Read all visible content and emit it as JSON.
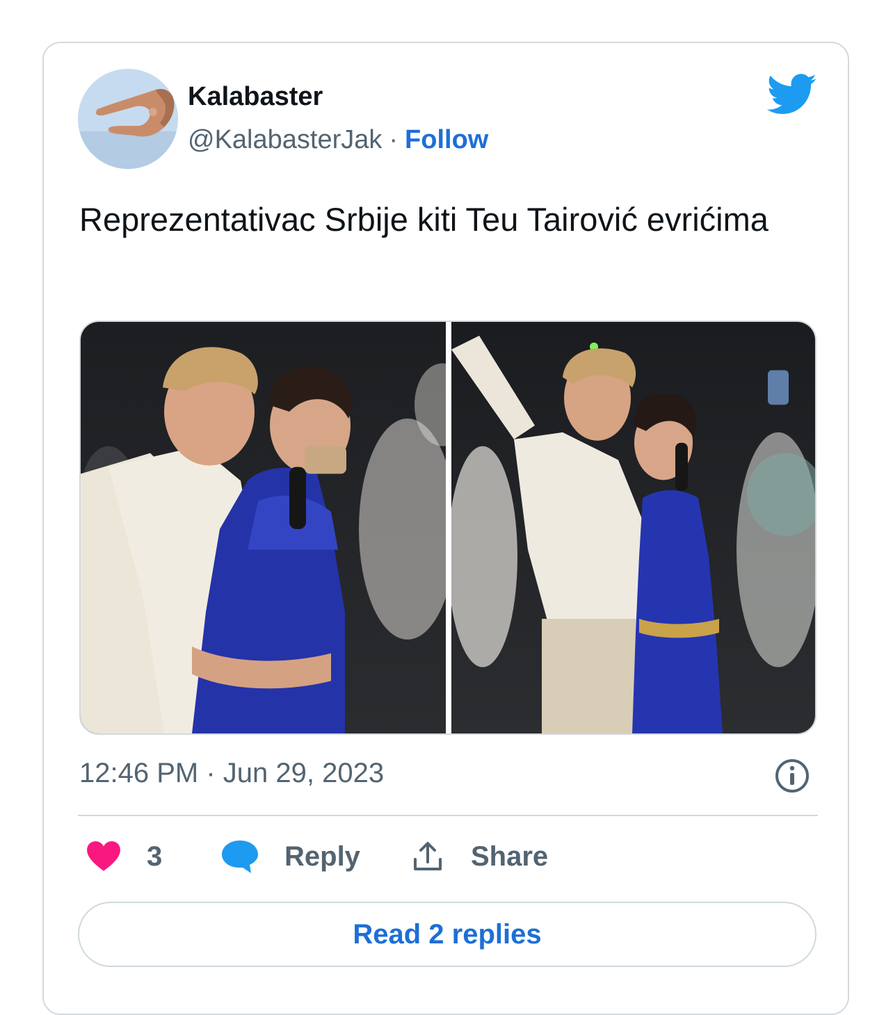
{
  "author": {
    "display_name": "Kalabaster",
    "handle": "@KalabasterJak",
    "separator": "·",
    "follow_label": "Follow",
    "avatar_icon": "hand-gesture-avatar"
  },
  "brand": {
    "icon": "twitter-bird-icon",
    "color": "#1d9bf0"
  },
  "tweet": {
    "text": "Reprezentativac Srbije kiti Teu Tairović evrićima",
    "media": [
      {
        "name": "photo-left"
      },
      {
        "name": "photo-right"
      }
    ],
    "timestamp": "12:46 PM · Jun 29, 2023"
  },
  "actions": {
    "like_count": "3",
    "like_color": "#f91880",
    "reply_label": "Reply",
    "reply_color": "#1d9bf0",
    "share_label": "Share"
  },
  "read_replies_label": "Read 2 replies",
  "colors": {
    "link": "#1d6fd6",
    "muted": "#536471",
    "border": "#cfd9de"
  }
}
